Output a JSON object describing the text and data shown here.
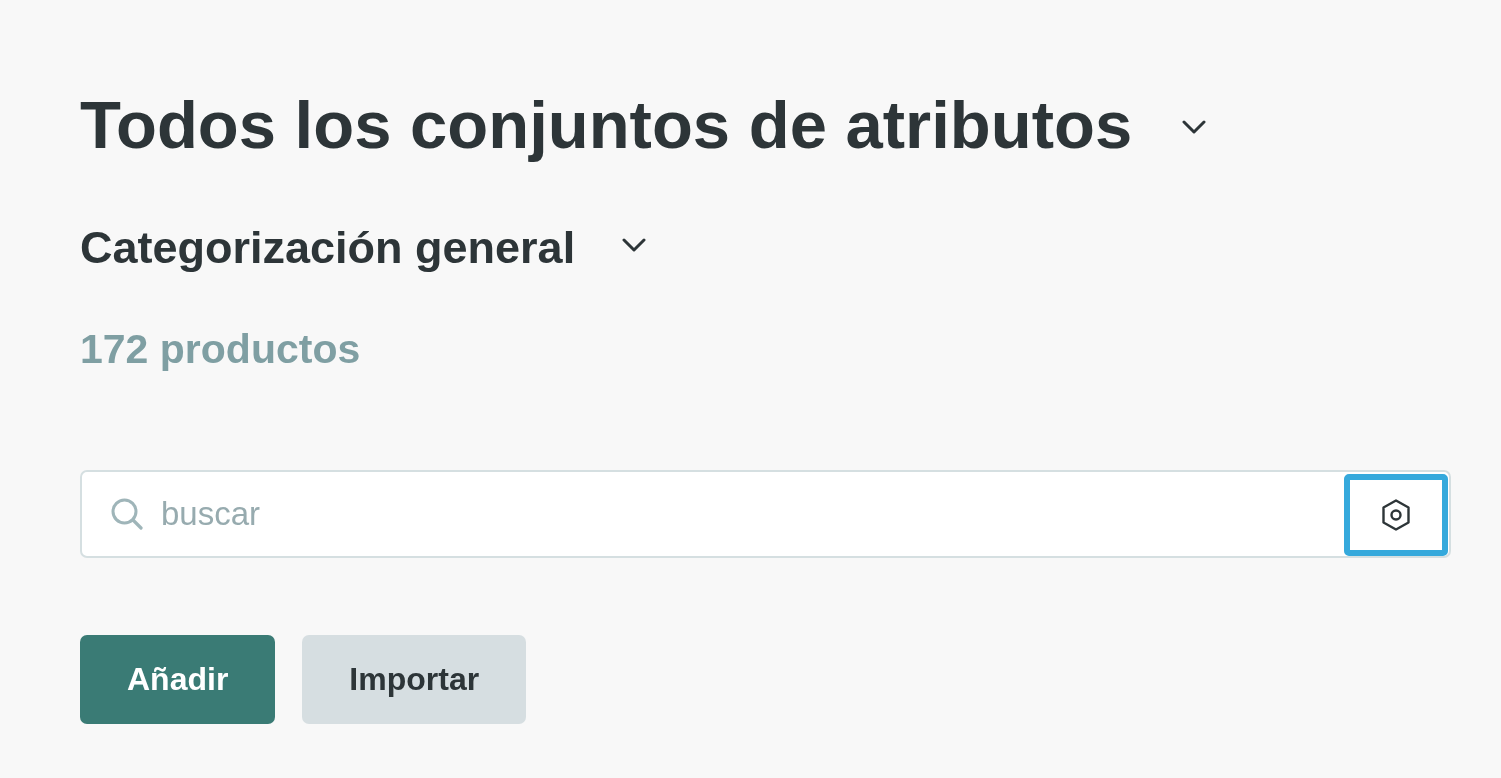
{
  "title": {
    "text": "Todos los conjuntos de atributos"
  },
  "subtitle": {
    "text": "Categorización general"
  },
  "product_count": "172 productos",
  "search": {
    "placeholder": "buscar",
    "settings_button": {
      "focused": true
    }
  },
  "buttons": [
    {
      "label": "Añadir",
      "kind": "primary"
    },
    {
      "label": "Importar",
      "kind": "secondary"
    }
  ]
}
